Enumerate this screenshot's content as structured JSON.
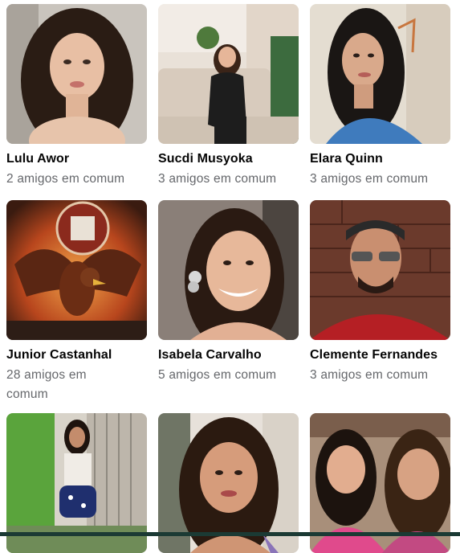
{
  "friend_suggestions": [
    {
      "name": "Lulu Awor",
      "mutual": "2 amigos em comum",
      "photo": "woman-curly-hair-photo"
    },
    {
      "name": "Sucdi Musyoka",
      "mutual": "3 amigos em comum",
      "photo": "woman-sitting-on-sofa-photo"
    },
    {
      "name": "Elara Quinn",
      "mutual": "3 amigos em comum",
      "photo": "woman-blue-shirt-photo"
    },
    {
      "name": "Junior Castanhal",
      "mutual": "28 amigos em comum",
      "photo": "eagle-emblem-photo"
    },
    {
      "name": "Isabela Carvalho",
      "mutual": "5 amigos em comum",
      "photo": "smiling-woman-photo"
    },
    {
      "name": "Clemente Fernandes",
      "mutual": "3 amigos em comum",
      "photo": "man-cap-sunglasses-photo"
    },
    {
      "name": "",
      "mutual": "",
      "photo": "woman-outdoor-photo"
    },
    {
      "name": "",
      "mutual": "",
      "photo": "woman-portrait-photo"
    },
    {
      "name": "",
      "mutual": "",
      "photo": "two-women-selfie-photo"
    }
  ]
}
